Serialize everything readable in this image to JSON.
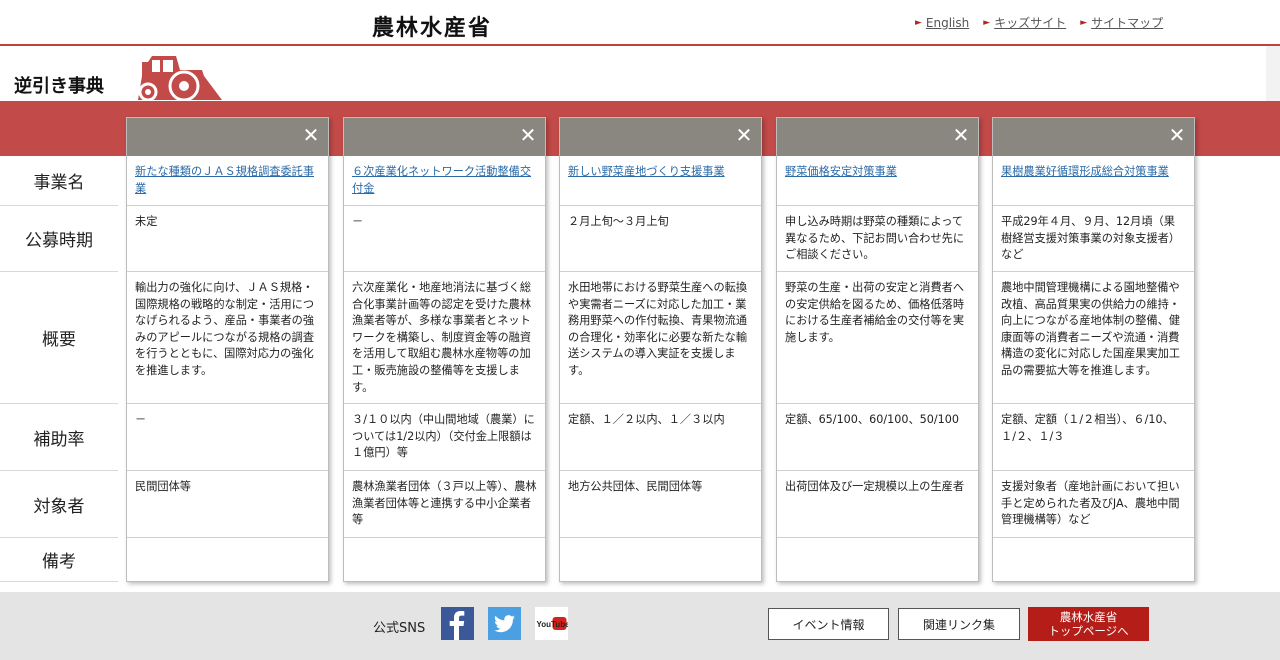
{
  "header": {
    "logo": "農林水産省",
    "links": [
      {
        "label": "English"
      },
      {
        "label": "キッズサイト"
      },
      {
        "label": "サイトマップ"
      }
    ]
  },
  "page_title": "逆引き事典",
  "row_labels": [
    "事業名",
    "公募時期",
    "概要",
    "補助率",
    "対象者",
    "備考"
  ],
  "cards": [
    {
      "name": "新たな種類のＪＡＳ規格調査委託事業",
      "period": "未定",
      "summary": "輸出力の強化に向け、ＪＡＳ規格・国際規格の戦略的な制定・活用につなげられるよう、産品・事業者の強みのアピールにつながる規格の調査を行うとともに、国際対応力の強化を推進します。",
      "rate": "－",
      "target": "民間団体等",
      "note": ""
    },
    {
      "name": "６次産業化ネットワーク活動整備交付金",
      "period": "－",
      "summary": "六次産業化・地産地消法に基づく総合化事業計画等の認定を受けた農林漁業者等が、多様な事業者とネットワークを構築し、制度資金等の融資を活用して取組む農林水産物等の加工・販売施設の整備等を支援します。",
      "rate": "３/１０以内（中山間地域（農業）については1/2以内）（交付金上限額は１億円）等",
      "target": "農林漁業者団体（３戸以上等）、農林漁業者団体等と連携する中小企業者等",
      "note": ""
    },
    {
      "name": "新しい野菜産地づくり支援事業",
      "period": "２月上旬～３月上旬",
      "summary": "水田地帯における野菜生産への転換や実需者ニーズに対応した加工・業務用野菜への作付転換、青果物流通の合理化・効率化に必要な新たな輸送システムの導入実証を支援します。",
      "rate": "定額、１／２以内、１／３以内",
      "target": "地方公共団体、民間団体等",
      "note": ""
    },
    {
      "name": "野菜価格安定対策事業",
      "period": "申し込み時期は野菜の種類によって異なるため、下記お問い合わせ先にご相談ください。",
      "summary": "野菜の生産・出荷の安定と消費者への安定供給を図るため、価格低落時における生産者補給金の交付等を実施します。",
      "rate": "定額、65/100、60/100、50/100",
      "target": "出荷団体及び一定規模以上の生産者",
      "note": ""
    },
    {
      "name": "果樹農業好循環形成総合対策事業",
      "period": "平成29年４月、９月、12月頃（果樹経営支援対策事業の対象支援者）など",
      "summary": "農地中間管理機構による園地整備や改植、高品質果実の供給力の維持・向上につながる産地体制の整備、健康面等の消費者ニーズや流通・消費構造の変化に対応した国産果実加工品の需要拡大等を推進します。",
      "rate": "定額、定額（１/２相当）、６/10、１/２、１/３",
      "target": "支援対象者（産地計画において担い手と定められた者及びJA、農地中間管理機構等）など",
      "note": ""
    }
  ],
  "footer": {
    "sns_label": "公式SNS",
    "youtube_text": "YouTube",
    "buttons": {
      "event": "イベント情報",
      "links": "関連リンク集",
      "top_line1": "農林水産省",
      "top_line2": "トップページへ"
    }
  },
  "colors": {
    "accent_red": "#c24a48",
    "card_header": "#8a8680",
    "link_blue": "#2a6aa8",
    "top_button": "#b41d18"
  }
}
